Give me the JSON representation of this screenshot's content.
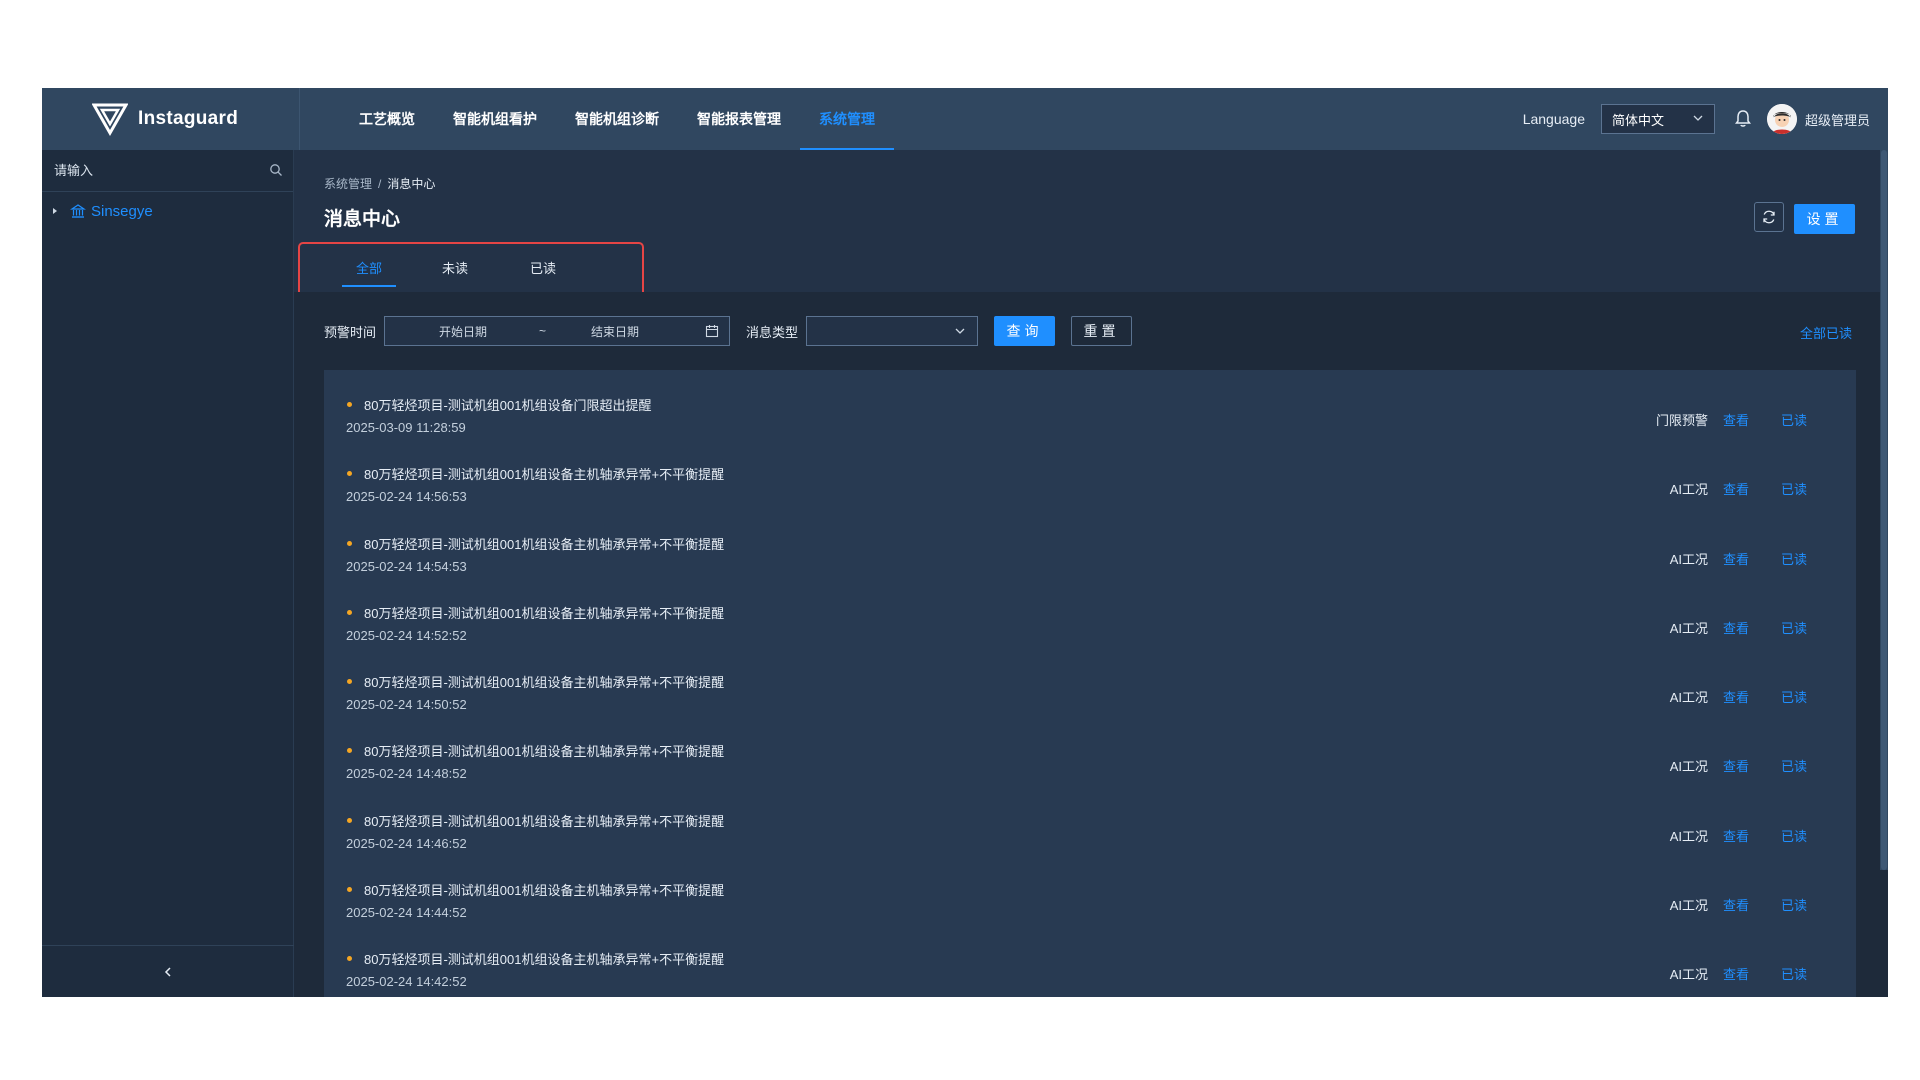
{
  "brand": {
    "name": "Instaguard"
  },
  "nav": [
    {
      "label": "工艺概览"
    },
    {
      "label": "智能机组看护"
    },
    {
      "label": "智能机组诊断"
    },
    {
      "label": "智能报表管理"
    },
    {
      "label": "系统管理",
      "active": true
    }
  ],
  "header": {
    "language_label": "Language",
    "language_value": "简体中文",
    "user_name": "超级管理员"
  },
  "sidebar": {
    "search_placeholder": "请输入",
    "tree": [
      {
        "label": "Sinsegye"
      }
    ]
  },
  "breadcrumb": {
    "parent": "系统管理",
    "separator": "/",
    "current": "消息中心"
  },
  "page_title": "消息中心",
  "settings_label": "设置",
  "tabs": [
    {
      "label": "全部",
      "active": true
    },
    {
      "label": "未读"
    },
    {
      "label": "已读"
    }
  ],
  "filters": {
    "time_label": "预警时间",
    "start_placeholder": "开始日期",
    "range_separator": "~",
    "end_placeholder": "结束日期",
    "type_label": "消息类型",
    "query_label": "查询",
    "reset_label": "重置",
    "mark_all_label": "全部已读"
  },
  "messages": [
    {
      "title": "80万轻烃项目-测试机组001机组设备门限超出提醒",
      "time": "2025-03-09 11:28:59",
      "type": "门限预警",
      "view": "查看",
      "read": "已读"
    },
    {
      "title": "80万轻烃项目-测试机组001机组设备主机轴承异常+不平衡提醒",
      "time": "2025-02-24 14:56:53",
      "type": "AI工况",
      "view": "查看",
      "read": "已读"
    },
    {
      "title": "80万轻烃项目-测试机组001机组设备主机轴承异常+不平衡提醒",
      "time": "2025-02-24 14:54:53",
      "type": "AI工况",
      "view": "查看",
      "read": "已读"
    },
    {
      "title": "80万轻烃项目-测试机组001机组设备主机轴承异常+不平衡提醒",
      "time": "2025-02-24 14:52:52",
      "type": "AI工况",
      "view": "查看",
      "read": "已读"
    },
    {
      "title": "80万轻烃项目-测试机组001机组设备主机轴承异常+不平衡提醒",
      "time": "2025-02-24 14:50:52",
      "type": "AI工况",
      "view": "查看",
      "read": "已读"
    },
    {
      "title": "80万轻烃项目-测试机组001机组设备主机轴承异常+不平衡提醒",
      "time": "2025-02-24 14:48:52",
      "type": "AI工况",
      "view": "查看",
      "read": "已读"
    },
    {
      "title": "80万轻烃项目-测试机组001机组设备主机轴承异常+不平衡提醒",
      "time": "2025-02-24 14:46:52",
      "type": "AI工况",
      "view": "查看",
      "read": "已读"
    },
    {
      "title": "80万轻烃项目-测试机组001机组设备主机轴承异常+不平衡提醒",
      "time": "2025-02-24 14:44:52",
      "type": "AI工况",
      "view": "查看",
      "read": "已读"
    },
    {
      "title": "80万轻烃项目-测试机组001机组设备主机轴承异常+不平衡提醒",
      "time": "2025-02-24 14:42:52",
      "type": "AI工况",
      "view": "查看",
      "read": "已读"
    }
  ],
  "colors": {
    "accent": "#1f8fff",
    "header_bg": "#304760",
    "sidebar_bg": "#1e2c3e",
    "list_bg": "#283a52",
    "dot": "#f5a623",
    "highlight_border": "#e54545"
  }
}
